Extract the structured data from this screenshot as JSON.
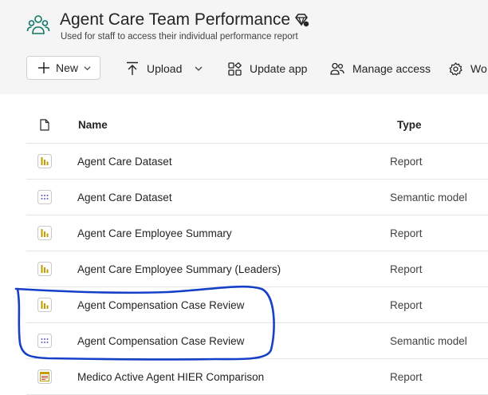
{
  "workspace": {
    "title": "Agent Care Team Performance",
    "subtitle": "Used for staff to access their individual performance report",
    "icon": "workspace-people-icon",
    "badge_icon": "premium-diamond-icon"
  },
  "toolbar": {
    "new_label": "New",
    "upload_label": "Upload",
    "update_label": "Update app",
    "manage_label": "Manage access",
    "workspace_settings_label": "Wo"
  },
  "columns": {
    "name": "Name",
    "type": "Type"
  },
  "items": [
    {
      "name": "Agent Care Dataset",
      "type": "Report",
      "icon": "report-icon"
    },
    {
      "name": "Agent Care Dataset",
      "type": "Semantic model",
      "icon": "semantic-model-icon"
    },
    {
      "name": "Agent Care Employee Summary",
      "type": "Report",
      "icon": "report-icon"
    },
    {
      "name": "Agent Care Employee Summary (Leaders)",
      "type": "Report",
      "icon": "report-icon"
    },
    {
      "name": "Agent Compensation Case Review",
      "type": "Report",
      "icon": "report-icon"
    },
    {
      "name": "Agent Compensation Case Review",
      "type": "Semantic model",
      "icon": "semantic-model-icon"
    },
    {
      "name": "Medico Active Agent HIER Comparison",
      "type": "Report",
      "icon": "paginated-report-icon"
    }
  ],
  "colors": {
    "report_icon": "#c19c00",
    "semantic_icon": "#5b5fc7",
    "annotation": "#1740c8",
    "accent": "#117865"
  }
}
